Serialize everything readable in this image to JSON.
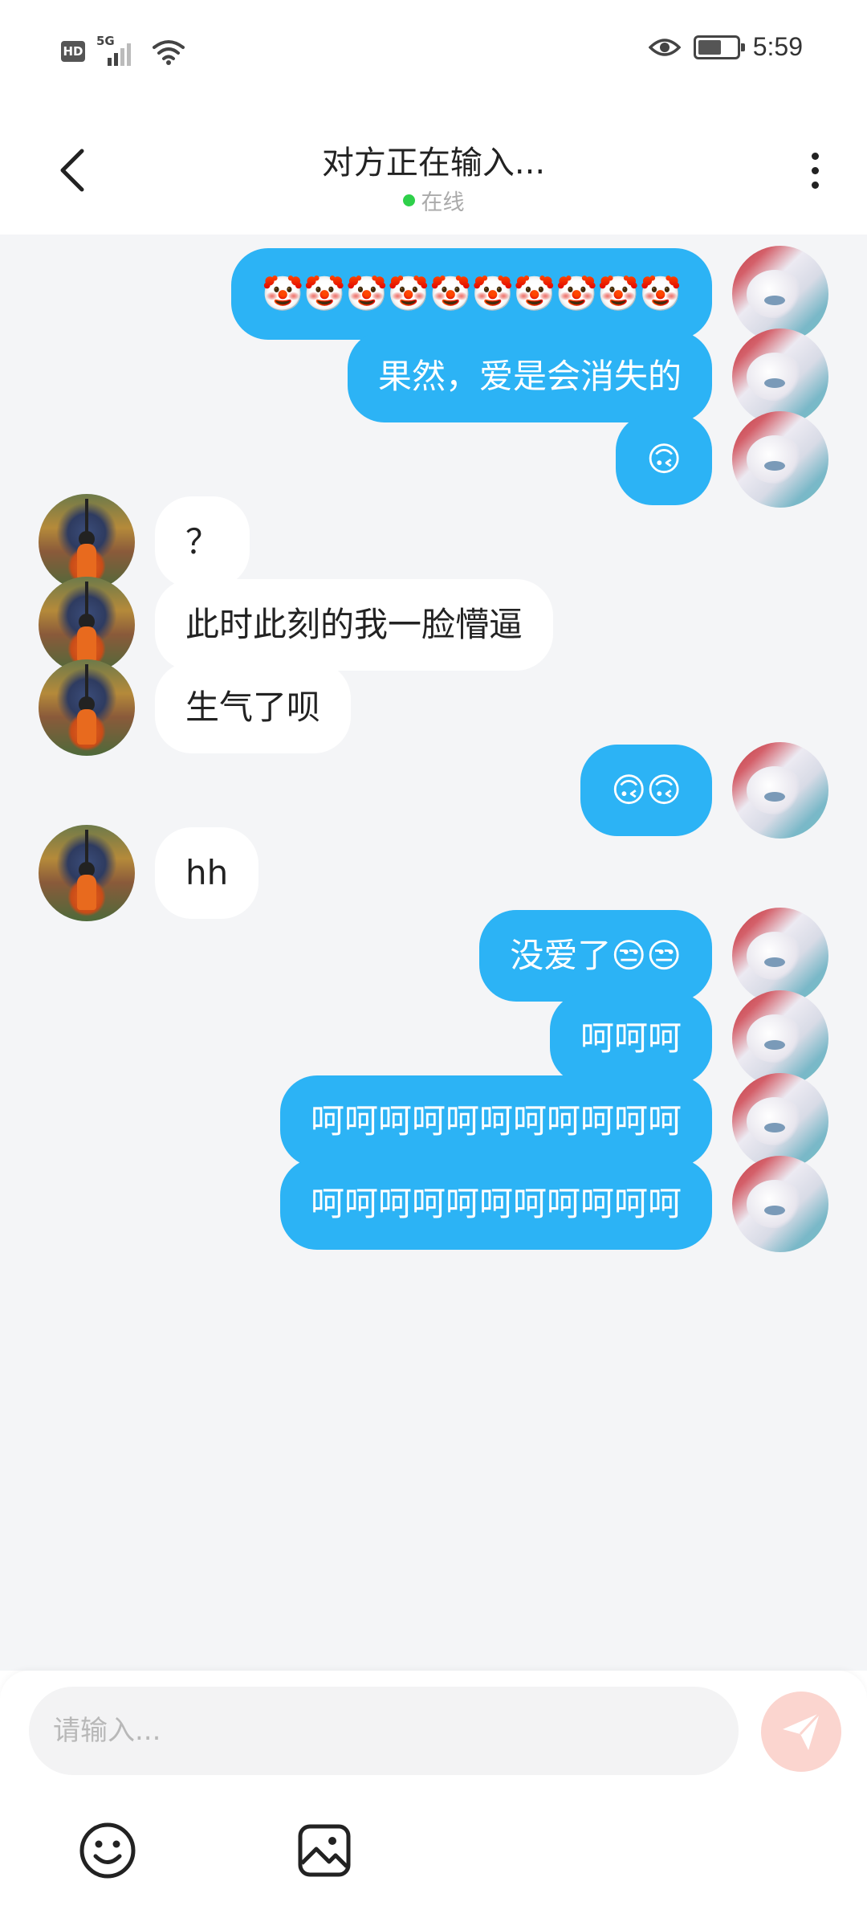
{
  "status_bar": {
    "time": "5:59",
    "hd_label": "HD",
    "network_label": "5G",
    "signal_bars": 2,
    "battery_level": 0.55,
    "icons": [
      "signal-icon",
      "wifi-icon",
      "eye-icon",
      "battery-icon"
    ]
  },
  "header": {
    "title": "对方正在输入...",
    "status": "在线",
    "status_color": "#2ed04a",
    "icons": [
      "chevron-left-icon",
      "more-vertical-icon"
    ]
  },
  "messages": [
    {
      "sender": "me",
      "text": "🤡🤡🤡🤡🤡🤡🤡🤡🤡🤡"
    },
    {
      "sender": "me",
      "text": "果然，爱是会消失的"
    },
    {
      "sender": "me",
      "text": "🙃"
    },
    {
      "sender": "other",
      "text": "？"
    },
    {
      "sender": "other",
      "text": "此时此刻的我一脸懵逼"
    },
    {
      "sender": "other",
      "text": "生气了呗"
    },
    {
      "sender": "me",
      "text": "🙃🙃"
    },
    {
      "sender": "other",
      "text": "hh"
    },
    {
      "sender": "me",
      "text": "没爱了😒😒"
    },
    {
      "sender": "me",
      "text": "呵呵呵"
    },
    {
      "sender": "me",
      "text": "呵呵呵呵呵呵呵呵呵呵呵"
    },
    {
      "sender": "me",
      "text": "呵呵呵呵呵呵呵呵呵呵呵"
    }
  ],
  "composer": {
    "placeholder": "请输入...",
    "value": "",
    "icons": [
      "send-icon",
      "emoji-icon",
      "image-icon"
    ]
  },
  "colors": {
    "my_bubble": "#2cb3f5",
    "their_bubble": "#ffffff",
    "chat_background": "#f4f5f7",
    "send_button": "#fbd5cf"
  }
}
